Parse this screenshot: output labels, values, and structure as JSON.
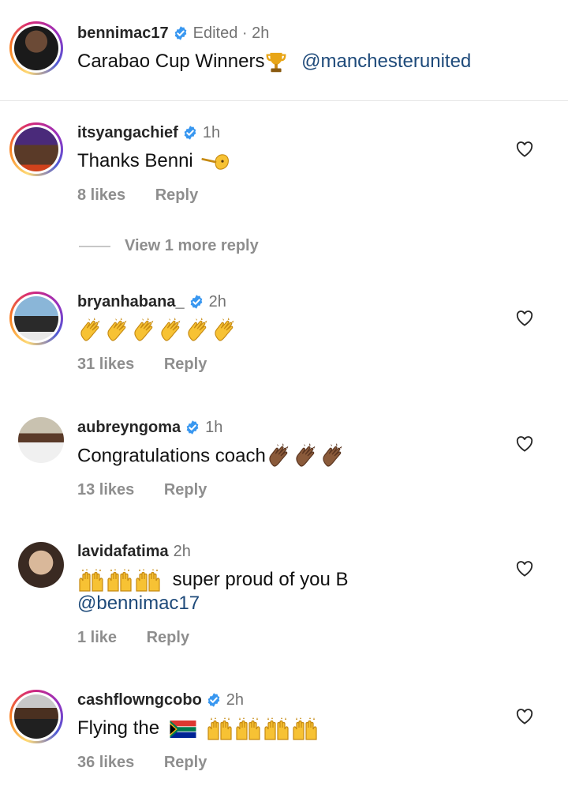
{
  "post": {
    "username": "bennimac17",
    "meta": "Edited · 2h",
    "text": "Carabao Cup Winners",
    "mention": "@manchesterunited"
  },
  "comments": [
    {
      "username": "itsyangachief",
      "time": "1h",
      "text": "Thanks Benni",
      "likes": "8 likes",
      "reply": "Reply"
    },
    {
      "username": "bryanhabana_",
      "time": "2h",
      "text": "",
      "likes": "31 likes",
      "reply": "Reply"
    },
    {
      "username": "aubreyngoma",
      "time": "1h",
      "text": "Congratulations coach",
      "likes": "13 likes",
      "reply": "Reply"
    },
    {
      "username": "lavidafatima",
      "time": "2h",
      "text": "super proud of you B",
      "mention": "@bennimac17",
      "likes": "1 like",
      "reply": "Reply"
    },
    {
      "username": "cashflowngcobo",
      "time": "2h",
      "text": "Flying the",
      "likes": "36 likes",
      "reply": "Reply"
    }
  ],
  "view_more": "View 1 more reply",
  "icons": [
    "verified-badge-icon",
    "heart-icon",
    "trophy-icon",
    "clapping-hands-icon",
    "raising-hands-icon",
    "south-africa-flag-icon",
    "saluting-hand-icon"
  ],
  "colors": {
    "verified": "#3897f0",
    "mention": "#1e4a7a",
    "muted": "#8e8e8e"
  }
}
